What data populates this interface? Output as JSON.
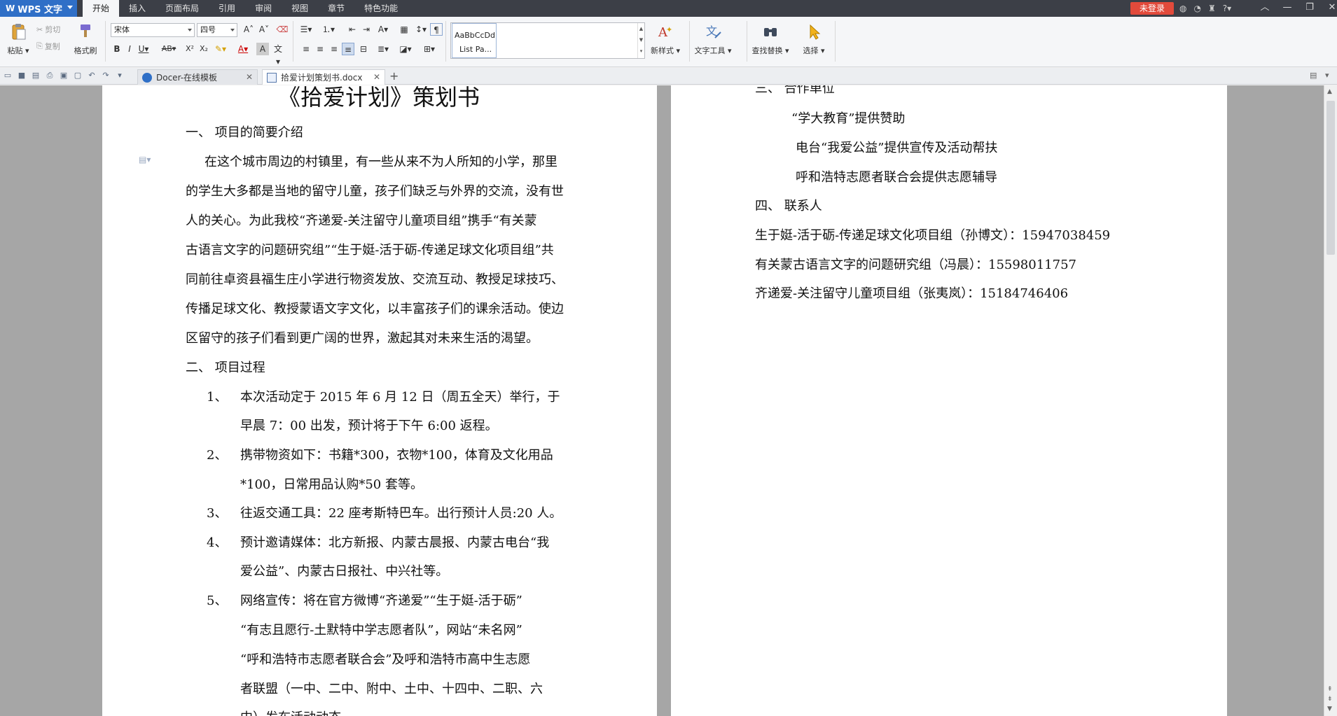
{
  "app": {
    "name": "WPS 文字",
    "login_label": "未登录"
  },
  "menu": {
    "items": [
      "开始",
      "插入",
      "页面布局",
      "引用",
      "审阅",
      "视图",
      "章节",
      "特色功能"
    ]
  },
  "ribbon": {
    "paste": "粘贴",
    "cut": "剪切",
    "copy": "复制",
    "format_painter": "格式刷",
    "font_name": "宋体",
    "font_size": "四号",
    "styles": [
      {
        "preview": "AaBbCcDd",
        "name": "List Pa..."
      }
    ],
    "new_style": "新样式",
    "text_tools": "文字工具",
    "find_replace": "查找替换",
    "select": "选择"
  },
  "tabs": [
    {
      "label": "Docer-在线模板"
    },
    {
      "label": "拾爱计划策划书.docx"
    }
  ],
  "document": {
    "title": "《拾爱计划》策划书",
    "page1_lines": [
      "一、  项目的简要介绍",
      "在这个城市周边的村镇里，有一些从来不为人所知的小学，那里",
      "的学生大多都是当地的留守儿童，孩子们缺乏与外界的交流，没有世",
      "人的关心。为此我校“齐递爱-关注留守儿童项目组”携手“有关蒙",
      "古语言文字的问题研究组”“生于娗-活于砺-传递足球文化项目组”共",
      "同前往卓资县福生庄小学进行物资发放、交流互动、教授足球技巧、",
      "传播足球文化、教授蒙语文字文化，以丰富孩子们的课余活动。使边",
      "区留守的孩子们看到更广阔的世界，激起其对未来生活的渴望。",
      "二、  项目过程"
    ],
    "list_numbers": [
      "1、",
      "2、",
      "3、",
      "4、",
      "5、"
    ],
    "list_lines": [
      "本次活动定于 2015 年 6 月 12 日（周五全天）举行，于",
      "早晨 7：00 出发，预计将于下午 6:00 返程。",
      "携带物资如下：书籍*300，衣物*100，体育及文化用品",
      "*100，日常用品认购*50 套等。",
      "往返交通工具：22 座考斯特巴车。出行预计人员:20 人。",
      "预计邀请媒体：北方新报、内蒙古晨报、内蒙古电台“我",
      "爱公益”、内蒙古日报社、中兴社等。",
      "网络宣传：将在官方微博“齐递爱”“生于娗-活于砺”",
      "“有志且愿行-土默特中学志愿者队”，网站“未名网”",
      "“呼和浩特市志愿者联合会”及呼和浩特市高中生志愿",
      "者联盟（一中、二中、附中、土中、十四中、二职、六",
      "中）发布活动动态"
    ],
    "page2_lines": [
      "三、  合作单位",
      "“学大教育”提供赞助",
      "电台“我爱公益”提供宣传及活动帮扶",
      "呼和浩特志愿者联合会提供志愿辅导",
      "四、  联系人",
      "生于娗-活于砺-传递足球文化项目组（孙博文）：15947038459",
      "有关蒙古语言文字的问题研究组（冯晨）：15598011757",
      "齐递爱-关注留守儿童项目组（张夷岚）：15184746406"
    ]
  }
}
